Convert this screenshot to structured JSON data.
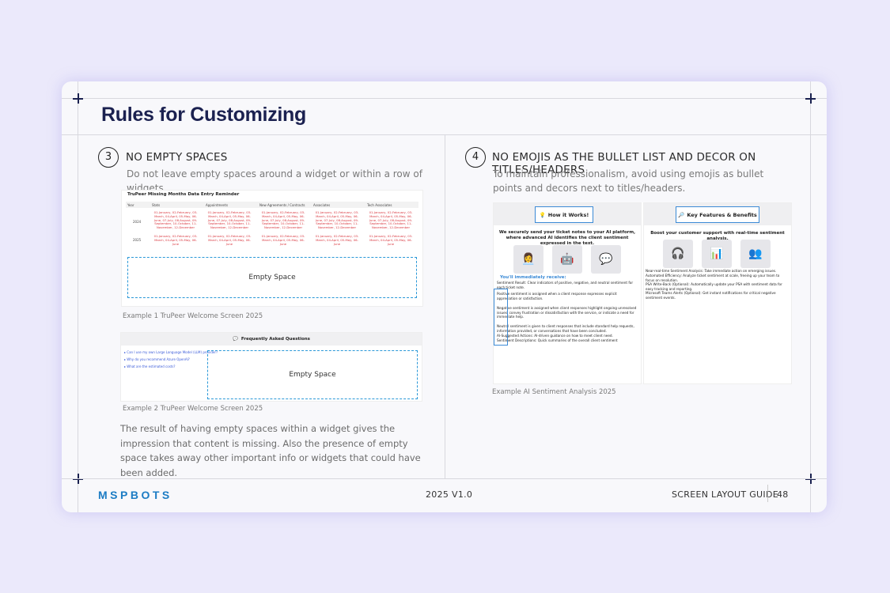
{
  "title": "Rules for Customizing",
  "left": {
    "number": "3",
    "heading": "NO EMPTY SPACES",
    "desc": "Do not leave empty spaces around a widget or within a row of widgets.",
    "example1": {
      "title": "TruPeer Missing Months Data Entry Reminder",
      "columns": [
        "Year",
        "Stats",
        "Appointments",
        "New Agreements / Contracts",
        "Associates",
        "Tech Associates"
      ],
      "years": [
        "2024",
        "2025"
      ],
      "row2024": "01-January, 02-February, 03-March, 04-April, 05-May, 06-June, 07-July, 08-August, 09-September, 10-October, 11-November, 12-December",
      "row2025": "01-January, 02-February, 03-March, 04-April, 05-May, 06-June",
      "empty_label": "Empty Space",
      "caption": "Example 1 TruPeer Welcome Screen 2025"
    },
    "example2": {
      "header": "Frequently Asked Questions",
      "questions": [
        "▸ Can I use my own Large Language Model (LLM) provider?",
        "▸ Why do you recommend Azure OpenAI?",
        "▸ What are the estimated costs?"
      ],
      "empty_label": "Empty Space",
      "caption": "Example 2 TruPeer Welcome Screen 2025"
    },
    "body": "The result of having empty spaces within a widget gives the impression that content is missing. Also the presence of empty space takes away other important info or widgets that could have been added."
  },
  "right": {
    "number": "4",
    "heading": "NO EMOJIS AS THE BULLET LIST AND DECOR ON TITLES/HEADERS",
    "desc": "To maintain professionalism, avoid using emojis as bullet points and decors next to titles/headers.",
    "card1": {
      "header": "How it Works!",
      "lead": "We securely send your ticket notes to your AI platform, where advanced AI identifies the client sentiment expressed in the text.",
      "receive": "You'll immediately receive:",
      "lines": [
        "Sentiment Result: Clear indicators of positive, negative, and neutral sentiment for each ticket note.",
        "Positive sentiment is assigned when a client response expresses explicit appreciation or satisfaction.",
        "Negative sentiment is assigned when client responses highlight ongoing unresolved issues, convey frustration or dissatisfaction with the service, or indicate a need for immediate help.",
        "Neutral sentiment is given to client responses that include standard help requests, information provided, or conversations that have been concluded.",
        "AI-Suggested Actions: AI-driven guidance on how to meet client need.",
        "Sentiment Descriptions: Quick summaries of the overall client sentiment"
      ]
    },
    "card2": {
      "header": "Key Features & Benefits",
      "lead": "Boost your customer support with real-time sentiment analysis.",
      "lines": [
        "Near-real-time Sentiment Analysis: Take immediate action on emerging issues.",
        "Automated Efficiency: Analyze ticket sentiment at scale, freeing up your team to focus on resolution.",
        "PSA Write-Back (Optional): Automatically update your PSA with sentiment data for easy tracking and reporting.",
        "Microsoft Teams Alerts (Optional): Get instant notifications for critical negative sentiment events."
      ]
    },
    "caption": "Example AI Sentiment Analysis 2025"
  },
  "footer": {
    "logo": "MSPBOTS",
    "version": "2025 V1.0",
    "guide": "SCREEN LAYOUT GUIDE",
    "page": "48"
  },
  "colors": {
    "background": "#ebe9fb",
    "title": "#1b2150",
    "accent": "#2a98d8",
    "red_text": "#d9363e",
    "logo": "#1c7cc4"
  }
}
